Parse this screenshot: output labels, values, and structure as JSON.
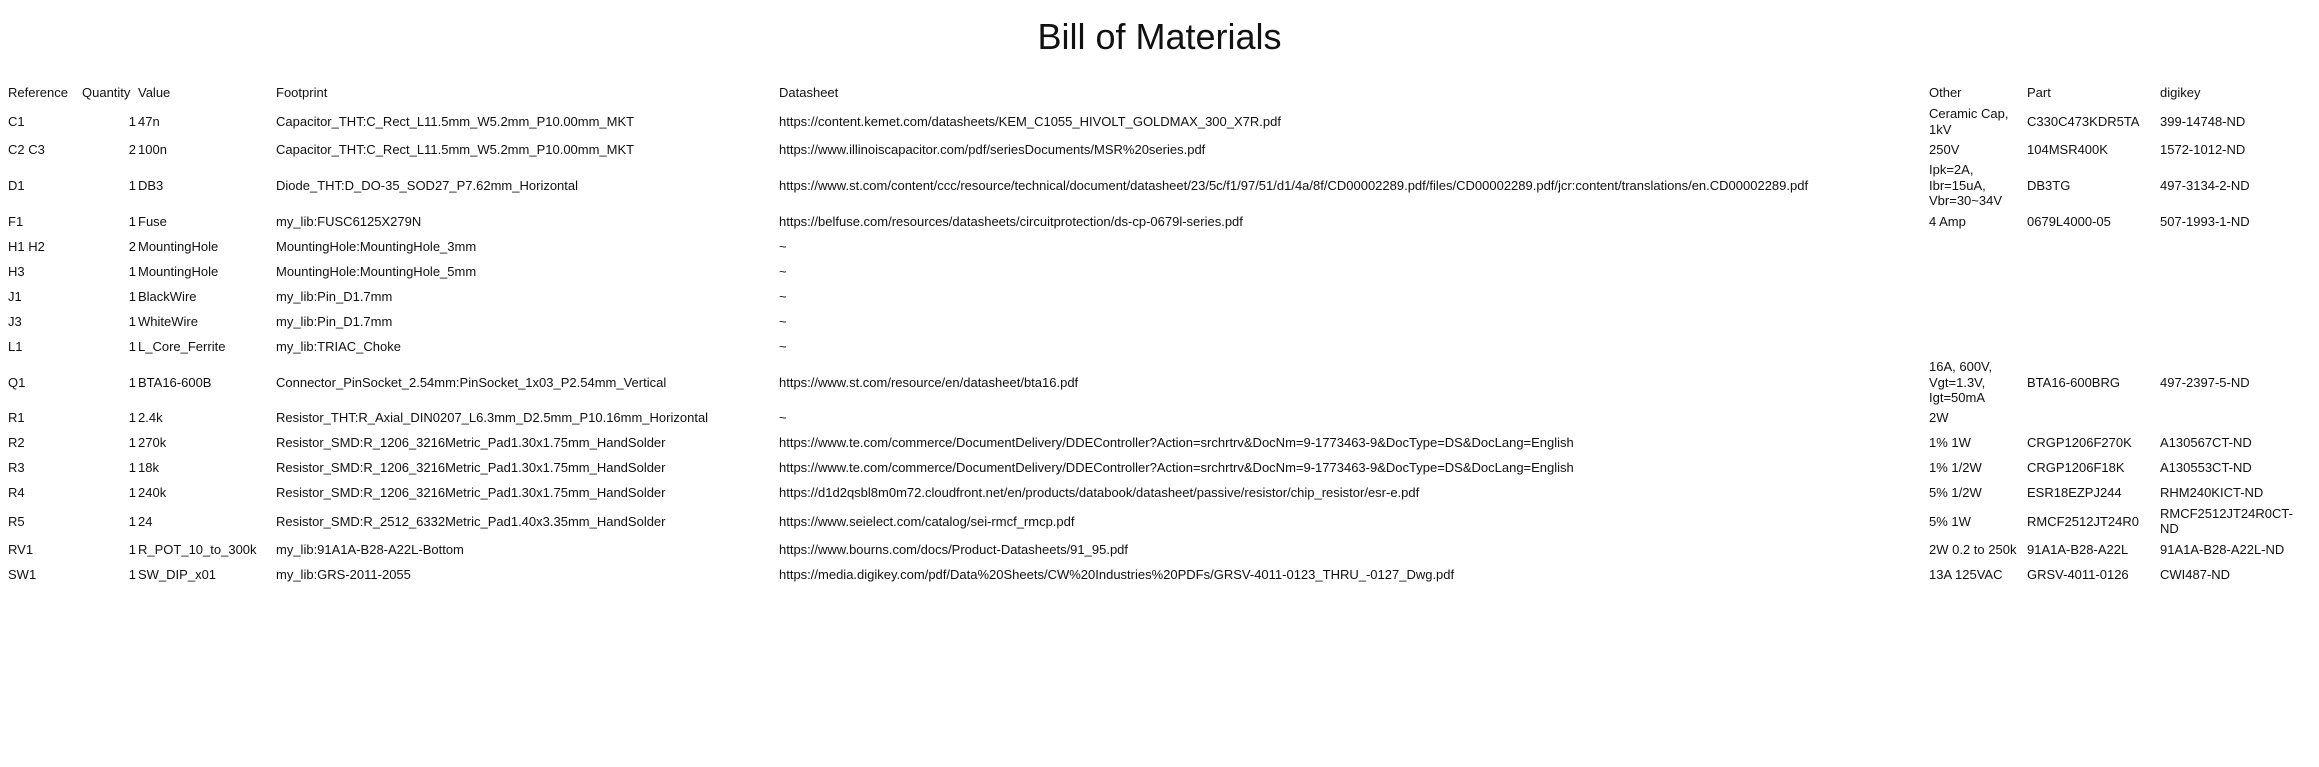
{
  "title": "Bill of Materials",
  "columns": [
    "Reference",
    "Quantity",
    "Value",
    "Footprint",
    "Datasheet",
    "Other",
    "Part",
    "digikey"
  ],
  "rows": [
    {
      "ref": "C1",
      "qty": "1",
      "value": "47n",
      "footprint": "Capacitor_THT:C_Rect_L11.5mm_W5.2mm_P10.00mm_MKT",
      "datasheet": "https://content.kemet.com/datasheets/KEM_C1055_HIVOLT_GOLDMAX_300_X7R.pdf",
      "other": "Ceramic Cap, 1kV",
      "part": "C330C473KDR5TA",
      "digikey": "399-14748-ND"
    },
    {
      "ref": "C2 C3",
      "qty": "2",
      "value": "100n",
      "footprint": "Capacitor_THT:C_Rect_L11.5mm_W5.2mm_P10.00mm_MKT",
      "datasheet": "https://www.illinoiscapacitor.com/pdf/seriesDocuments/MSR%20series.pdf",
      "other": "250V",
      "part": "104MSR400K",
      "digikey": "1572-1012-ND"
    },
    {
      "ref": "D1",
      "qty": "1",
      "value": "DB3",
      "footprint": "Diode_THT:D_DO-35_SOD27_P7.62mm_Horizontal",
      "datasheet": "https://www.st.com/content/ccc/resource/technical/document/datasheet/23/5c/f1/97/51/d1/4a/8f/CD00002289.pdf/files/CD00002289.pdf/jcr:content/translations/en.CD00002289.pdf",
      "other": "Ipk=2A, Ibr=15uA, Vbr=30~34V",
      "part": "DB3TG",
      "digikey": "497-3134-2-ND"
    },
    {
      "ref": "F1",
      "qty": "1",
      "value": "Fuse",
      "footprint": "my_lib:FUSC6125X279N",
      "datasheet": "https://belfuse.com/resources/datasheets/circuitprotection/ds-cp-0679l-series.pdf",
      "other": "4 Amp",
      "part": "0679L4000-05",
      "digikey": "507-1993-1-ND"
    },
    {
      "ref": "H1 H2",
      "qty": "2",
      "value": "MountingHole",
      "footprint": "MountingHole:MountingHole_3mm",
      "datasheet": "~",
      "other": "",
      "part": "",
      "digikey": ""
    },
    {
      "ref": "H3",
      "qty": "1",
      "value": "MountingHole",
      "footprint": "MountingHole:MountingHole_5mm",
      "datasheet": "~",
      "other": "",
      "part": "",
      "digikey": ""
    },
    {
      "ref": "J1",
      "qty": "1",
      "value": "BlackWire",
      "footprint": "my_lib:Pin_D1.7mm",
      "datasheet": "~",
      "other": "",
      "part": "",
      "digikey": ""
    },
    {
      "ref": "J3",
      "qty": "1",
      "value": "WhiteWire",
      "footprint": "my_lib:Pin_D1.7mm",
      "datasheet": "~",
      "other": "",
      "part": "",
      "digikey": ""
    },
    {
      "ref": "L1",
      "qty": "1",
      "value": "L_Core_Ferrite",
      "footprint": "my_lib:TRIAC_Choke",
      "datasheet": "~",
      "other": "",
      "part": "",
      "digikey": ""
    },
    {
      "ref": "Q1",
      "qty": "1",
      "value": "BTA16-600B",
      "footprint": "Connector_PinSocket_2.54mm:PinSocket_1x03_P2.54mm_Vertical",
      "datasheet": "https://www.st.com/resource/en/datasheet/bta16.pdf",
      "other": "16A, 600V, Vgt=1.3V, Igt=50mA",
      "part": "BTA16-600BRG",
      "digikey": "497-2397-5-ND"
    },
    {
      "ref": "R1",
      "qty": "1",
      "value": "2.4k",
      "footprint": "Resistor_THT:R_Axial_DIN0207_L6.3mm_D2.5mm_P10.16mm_Horizontal",
      "datasheet": "~",
      "other": "2W",
      "part": "",
      "digikey": ""
    },
    {
      "ref": "R2",
      "qty": "1",
      "value": "270k",
      "footprint": "Resistor_SMD:R_1206_3216Metric_Pad1.30x1.75mm_HandSolder",
      "datasheet": "https://www.te.com/commerce/DocumentDelivery/DDEController?Action=srchrtrv&DocNm=9-1773463-9&DocType=DS&DocLang=English",
      "other": "1% 1W",
      "part": "CRGP1206F270K",
      "digikey": "A130567CT-ND"
    },
    {
      "ref": "R3",
      "qty": "1",
      "value": "18k",
      "footprint": "Resistor_SMD:R_1206_3216Metric_Pad1.30x1.75mm_HandSolder",
      "datasheet": "https://www.te.com/commerce/DocumentDelivery/DDEController?Action=srchrtrv&DocNm=9-1773463-9&DocType=DS&DocLang=English",
      "other": "1% 1/2W",
      "part": "CRGP1206F18K",
      "digikey": "A130553CT-ND"
    },
    {
      "ref": "R4",
      "qty": "1",
      "value": "240k",
      "footprint": "Resistor_SMD:R_1206_3216Metric_Pad1.30x1.75mm_HandSolder",
      "datasheet": "https://d1d2qsbl8m0m72.cloudfront.net/en/products/databook/datasheet/passive/resistor/chip_resistor/esr-e.pdf",
      "other": "5% 1/2W",
      "part": "ESR18EZPJ244",
      "digikey": "RHM240KICT-ND"
    },
    {
      "ref": "R5",
      "qty": "1",
      "value": "24",
      "footprint": "Resistor_SMD:R_2512_6332Metric_Pad1.40x3.35mm_HandSolder",
      "datasheet": "https://www.seielect.com/catalog/sei-rmcf_rmcp.pdf",
      "other": "5% 1W",
      "part": "RMCF2512JT24R0",
      "digikey": "RMCF2512JT24R0CT-ND"
    },
    {
      "ref": "RV1",
      "qty": "1",
      "value": "R_POT_10_to_300k",
      "footprint": "my_lib:91A1A-B28-A22L-Bottom",
      "datasheet": "https://www.bourns.com/docs/Product-Datasheets/91_95.pdf",
      "other": "2W 0.2 to 250k",
      "part": "91A1A-B28-A22L",
      "digikey": "91A1A-B28-A22L-ND"
    },
    {
      "ref": "SW1",
      "qty": "1",
      "value": "SW_DIP_x01",
      "footprint": "my_lib:GRS-2011-2055",
      "datasheet": "https://media.digikey.com/pdf/Data%20Sheets/CW%20Industries%20PDFs/GRSV-4011-0123_THRU_-0127_Dwg.pdf",
      "other": "13A 125VAC",
      "part": "GRSV-4011-0126",
      "digikey": "CWI487-ND"
    }
  ]
}
